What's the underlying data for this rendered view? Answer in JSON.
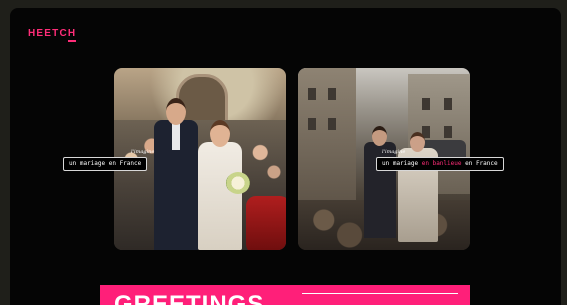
{
  "brand": {
    "name": "HEETCH"
  },
  "cards": [
    {
      "id": "left",
      "small_label": "l'imagine",
      "caption_parts": [
        "un mariage en France",
        "",
        ""
      ]
    },
    {
      "id": "right",
      "small_label": "l'imagine",
      "caption_parts": [
        "un mariage ",
        "en banlieue",
        " en France"
      ]
    }
  ],
  "banner": {
    "text": "GREETINGS"
  },
  "colors": {
    "accent": "#ff2d78",
    "background": "#050505"
  }
}
